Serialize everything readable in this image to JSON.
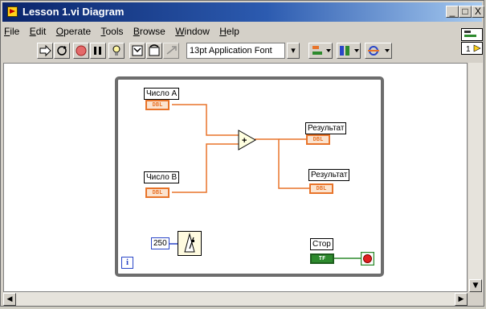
{
  "window": {
    "title": "Lesson 1.vi Diagram",
    "min_label": "_",
    "max_label": "□",
    "close_label": "X"
  },
  "menu": [
    "File",
    "Edit",
    "Operate",
    "Tools",
    "Browse",
    "Window",
    "Help"
  ],
  "toolbar": {
    "font_label": "13pt Application Font",
    "dropdown_arrow": "▾",
    "tool_icons": [
      "run-arrow-icon",
      "run-continuously-icon",
      "abort-icon",
      "pause-icon",
      "highlight-execution-icon",
      "step-into-icon",
      "step-over-icon",
      "step-out-icon",
      "align-objects-icon",
      "distribute-objects-icon",
      "reorder-icon"
    ]
  },
  "diagram": {
    "control_a": {
      "label": "Число A",
      "type": "DBL"
    },
    "control_b": {
      "label": "Число B",
      "type": "DBL"
    },
    "add_operator": "+",
    "indicator_1": {
      "label": "Результат",
      "type": "DBL"
    },
    "indicator_2": {
      "label": "Результат",
      "type": "DBL"
    },
    "wait_constant": "250",
    "stop": {
      "label": "Стор",
      "type": "TF"
    },
    "iteration": "i"
  },
  "connector_pane_value": "1",
  "colors": {
    "title_gradient_start": "#0a246a",
    "title_gradient_end": "#a6caf0",
    "dbl_wire": "#e8742a",
    "bool_wire": "#2d8a2d",
    "int_wire": "#2a46c8",
    "loop_border": "#6d6d6d"
  }
}
